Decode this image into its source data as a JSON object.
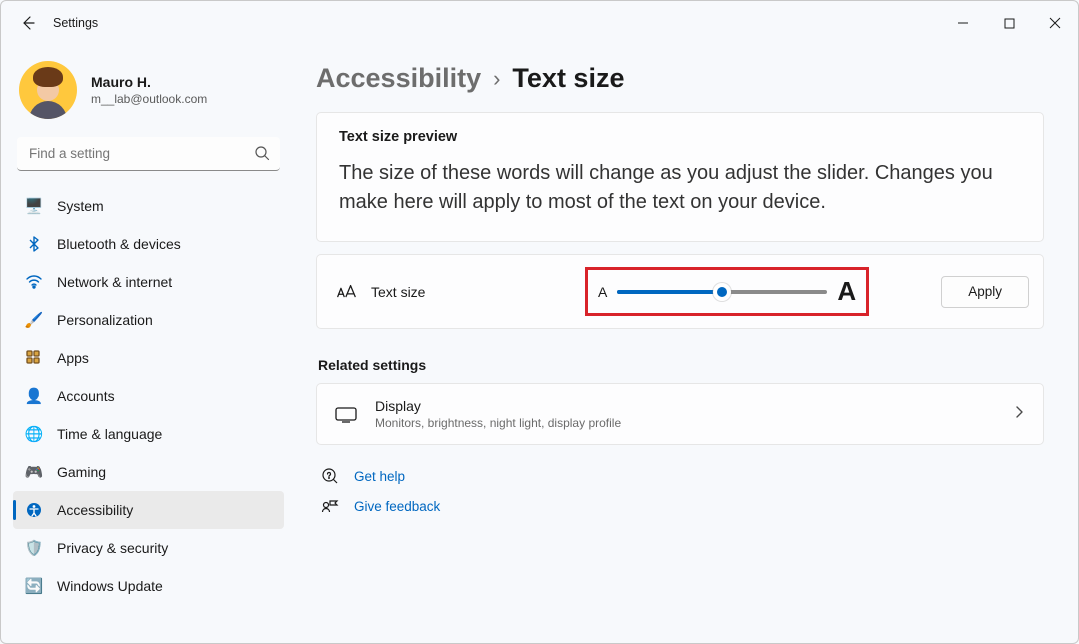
{
  "titlebar": {
    "title": "Settings"
  },
  "user": {
    "name": "Mauro H.",
    "email": "m__lab@outlook.com"
  },
  "search": {
    "placeholder": "Find a setting"
  },
  "sidebar": {
    "items": [
      {
        "label": "System",
        "icon": "🖥️"
      },
      {
        "label": "Bluetooth & devices",
        "icon": "bt"
      },
      {
        "label": "Network & internet",
        "icon": "wifi"
      },
      {
        "label": "Personalization",
        "icon": "🖌️"
      },
      {
        "label": "Apps",
        "icon": "apps"
      },
      {
        "label": "Accounts",
        "icon": "👤"
      },
      {
        "label": "Time & language",
        "icon": "🌐"
      },
      {
        "label": "Gaming",
        "icon": "🎮"
      },
      {
        "label": "Accessibility",
        "icon": "acc"
      },
      {
        "label": "Privacy & security",
        "icon": "🛡️"
      },
      {
        "label": "Windows Update",
        "icon": "🔄"
      }
    ],
    "active_index": 8
  },
  "breadcrumb": {
    "category": "Accessibility",
    "page": "Text size"
  },
  "preview": {
    "title": "Text size preview",
    "body": "The size of these words will change as you adjust the slider. Changes you make here will apply to most of the text on your device."
  },
  "slider": {
    "label": "Text size",
    "small_glyph": "A",
    "large_glyph": "A",
    "apply_label": "Apply",
    "value_pct": 50
  },
  "related": {
    "title": "Related settings",
    "display": {
      "title": "Display",
      "subtitle": "Monitors, brightness, night light, display profile"
    }
  },
  "help": {
    "get_help": "Get help",
    "feedback": "Give feedback"
  }
}
